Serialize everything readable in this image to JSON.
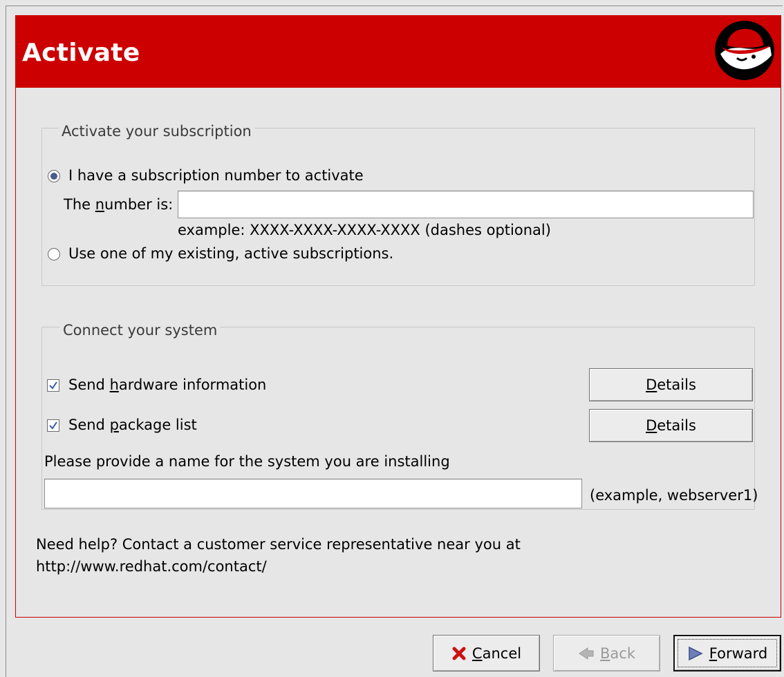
{
  "header": {
    "title": "Activate",
    "accent_color": "#cc0000"
  },
  "subscription_group": {
    "legend": "Activate your subscription",
    "option_have_number": {
      "label": "I have a subscription number to activate",
      "selected": true
    },
    "number_label_prefix": "The ",
    "number_label_mnemonic": "n",
    "number_label_suffix": "umber is:",
    "number_value": "",
    "example_text": "example: XXXX-XXXX-XXXX-XXXX (dashes optional)",
    "option_existing": {
      "label": "Use one of my existing, active subscriptions.",
      "selected": false
    }
  },
  "connect_group": {
    "legend": "Connect your system",
    "hardware": {
      "label_prefix": "Send ",
      "label_mnemonic": "h",
      "label_suffix": "ardware information",
      "checked": true,
      "details_mnemonic": "D",
      "details_rest": "etails"
    },
    "packages": {
      "label_prefix": "Send ",
      "label_mnemonic": "p",
      "label_suffix": "ackage list",
      "checked": true,
      "details_mnemonic": "D",
      "details_rest": "etails"
    },
    "system_name_prompt": "Please provide a name for the system you are installing",
    "system_name_value": "",
    "system_name_example": "(example, webserver1)"
  },
  "help": {
    "line1": "Need help? Contact a customer service representative near you at",
    "line2": "http://www.redhat.com/contact/"
  },
  "buttons": {
    "cancel": {
      "mnemonic": "C",
      "rest": "ancel",
      "icon": "x-icon",
      "enabled": true
    },
    "back": {
      "mnemonic": "B",
      "rest": "ack",
      "icon": "arrow-left-icon",
      "enabled": false
    },
    "forward": {
      "mnemonic": "F",
      "rest": "orward",
      "icon": "arrow-right-icon",
      "enabled": true
    }
  }
}
